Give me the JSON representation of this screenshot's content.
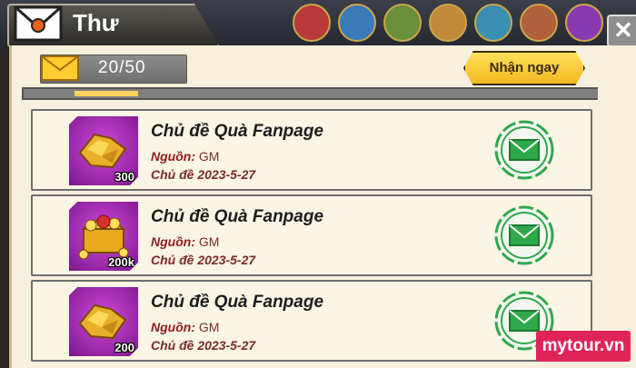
{
  "header": {
    "title": "Thư",
    "close_label": "✕",
    "mail_icon": "envelope-icon"
  },
  "mailbox": {
    "count": "20/50",
    "claim_all_label": "Nhận ngay"
  },
  "mails": [
    {
      "title": "Chủ đề Quà Fanpage",
      "source_label": "Nguồn:",
      "source": "GM",
      "date_label": "Chủ đề",
      "date": "2023-5-27",
      "quantity": "300",
      "reward_icon": "gold-ingot-icon"
    },
    {
      "title": "Chủ đề Quà Fanpage",
      "source_label": "Nguồn:",
      "source": "GM",
      "date_label": "Chủ đề",
      "date": "2023-5-27",
      "quantity": "200k",
      "reward_icon": "treasure-chest-icon"
    },
    {
      "title": "Chủ đề Quà Fanpage",
      "source_label": "Nguồn:",
      "source": "GM",
      "date_label": "Chủ đề",
      "date": "2023-5-27",
      "quantity": "200",
      "reward_icon": "gold-ingot-icon"
    }
  ],
  "watermark": "mytour.vn",
  "colors": {
    "panel": "#f6f0dc",
    "accent_yellow": "#f2b81e",
    "open_green": "#2fa84a",
    "item_purple": "#9b2aad"
  }
}
